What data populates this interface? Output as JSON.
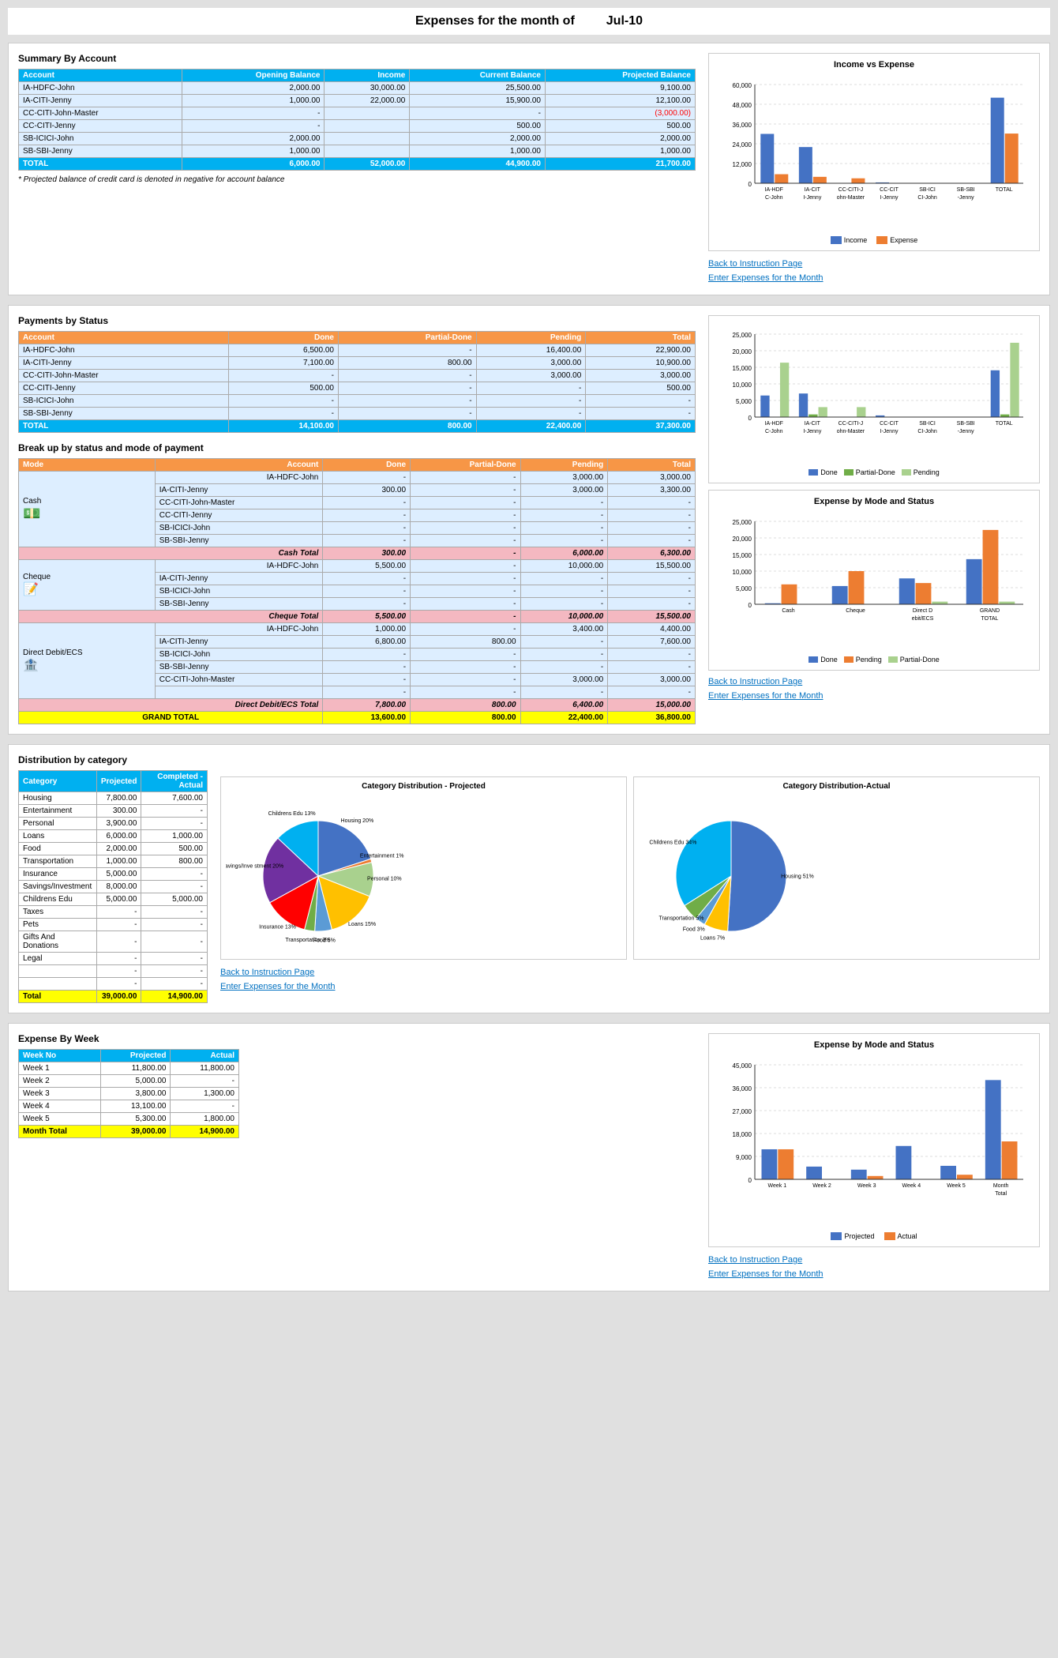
{
  "page": {
    "title": "Expenses for the month of",
    "month": "Jul-10"
  },
  "section1": {
    "title": "Summary By Account",
    "table": {
      "headers": [
        "Account",
        "Opening Balance",
        "Income",
        "Current Balance",
        "Projected Balance"
      ],
      "rows": [
        {
          "account": "IA-HDFC-John",
          "opening": "2,000.00",
          "income": "30,000.00",
          "current": "25,500.00",
          "projected": "9,100.00",
          "neg": false
        },
        {
          "account": "IA-CITI-Jenny",
          "opening": "1,000.00",
          "income": "22,000.00",
          "current": "15,900.00",
          "projected": "12,100.00",
          "neg": false
        },
        {
          "account": "CC-CITI-John-Master",
          "opening": "-",
          "income": "",
          "current": "-",
          "projected": "(3,000.00)",
          "neg": true
        },
        {
          "account": "CC-CITI-Jenny",
          "opening": "-",
          "income": "",
          "current": "500.00",
          "projected": "500.00",
          "neg": false
        },
        {
          "account": "SB-ICICI-John",
          "opening": "2,000.00",
          "income": "",
          "current": "2,000.00",
          "projected": "2,000.00",
          "neg": false
        },
        {
          "account": "SB-SBI-Jenny",
          "opening": "1,000.00",
          "income": "",
          "current": "1,000.00",
          "projected": "1,000.00",
          "neg": false
        }
      ],
      "total": {
        "account": "TOTAL",
        "opening": "6,000.00",
        "income": "52,000.00",
        "current": "44,900.00",
        "projected": "21,700.00"
      }
    },
    "note": "* Projected balance of credit card is denoted in negative for account balance",
    "chart": {
      "title": "Income vs Expense",
      "categories": [
        "IA-HDFC-John",
        "IA-CITI-Jenny",
        "CC-CITI-John-Master",
        "CC-CITI-Jenny",
        "SB-ICICI-John",
        "SB-SBI-Jenny",
        "TOTAL"
      ],
      "income": [
        30000,
        22000,
        0,
        500,
        0,
        0,
        52000
      ],
      "expense": [
        5500,
        3900,
        3000,
        0,
        0,
        0,
        30200
      ]
    },
    "links": [
      "Back to Instruction Page",
      "Enter Expenses for the Month"
    ]
  },
  "section2": {
    "title": "Payments by Status",
    "table": {
      "headers": [
        "Account",
        "Done",
        "Partial-Done",
        "Pending",
        "Total"
      ],
      "rows": [
        {
          "account": "IA-HDFC-John",
          "done": "6,500.00",
          "partial": "-",
          "pending": "16,400.00",
          "total": "22,900.00"
        },
        {
          "account": "IA-CITI-Jenny",
          "done": "7,100.00",
          "partial": "800.00",
          "pending": "3,000.00",
          "total": "10,900.00"
        },
        {
          "account": "CC-CITI-John-Master",
          "done": "-",
          "partial": "-",
          "pending": "3,000.00",
          "total": "3,000.00"
        },
        {
          "account": "CC-CITI-Jenny",
          "done": "500.00",
          "partial": "-",
          "pending": "-",
          "total": "500.00"
        },
        {
          "account": "SB-ICICI-John",
          "done": "-",
          "partial": "-",
          "pending": "-",
          "total": "-"
        },
        {
          "account": "SB-SBI-Jenny",
          "done": "-",
          "partial": "-",
          "pending": "-",
          "total": "-"
        }
      ],
      "total": {
        "account": "TOTAL",
        "done": "14,100.00",
        "partial": "800.00",
        "pending": "22,400.00",
        "total": "37,300.00"
      }
    },
    "chart1": {
      "title": "Payments by Status",
      "categories": [
        "IA-HDFC-John",
        "IA-CITI-Jenny",
        "CC-CITI-John-Master",
        "CC-CITI-Jenny",
        "SB-ICICI-John",
        "SB-SBI-Jenny",
        "TOTAL"
      ],
      "done": [
        6500,
        7100,
        0,
        500,
        0,
        0,
        14100
      ],
      "partial": [
        0,
        800,
        0,
        0,
        0,
        0,
        800
      ],
      "pending": [
        16400,
        3000,
        3000,
        0,
        0,
        0,
        22400
      ]
    },
    "breakdown_title": "Break up by status and mode of payment",
    "breakdown_table": {
      "headers": [
        "Mode",
        "Account",
        "Done",
        "Partial-Done",
        "Pending",
        "Total"
      ],
      "cash_rows": [
        {
          "account": "IA-HDFC-John",
          "done": "-",
          "partial": "-",
          "pending": "3,000.00",
          "total": "3,000.00"
        },
        {
          "account": "IA-CITI-Jenny",
          "done": "300.00",
          "partial": "-",
          "pending": "3,000.00",
          "total": "3,300.00"
        },
        {
          "account": "CC-CITI-John-Master",
          "done": "-",
          "partial": "-",
          "pending": "-",
          "total": "-"
        },
        {
          "account": "CC-CITI-Jenny",
          "done": "-",
          "partial": "-",
          "pending": "-",
          "total": "-"
        },
        {
          "account": "SB-ICICI-John",
          "done": "-",
          "partial": "-",
          "pending": "-",
          "total": "-"
        },
        {
          "account": "SB-SBI-Jenny",
          "done": "-",
          "partial": "-",
          "pending": "-",
          "total": "-"
        }
      ],
      "cash_total": {
        "done": "300.00",
        "partial": "-",
        "pending": "6,000.00",
        "total": "6,300.00"
      },
      "cheque_rows": [
        {
          "account": "IA-HDFC-John",
          "done": "5,500.00",
          "partial": "-",
          "pending": "10,000.00",
          "total": "15,500.00"
        },
        {
          "account": "IA-CITI-Jenny",
          "done": "-",
          "partial": "-",
          "pending": "-",
          "total": "-"
        },
        {
          "account": "SB-ICICI-John",
          "done": "-",
          "partial": "-",
          "pending": "-",
          "total": "-"
        },
        {
          "account": "SB-SBI-Jenny",
          "done": "-",
          "partial": "-",
          "pending": "-",
          "total": "-"
        }
      ],
      "cheque_total": {
        "done": "5,500.00",
        "partial": "-",
        "pending": "10,000.00",
        "total": "15,500.00"
      },
      "dd_rows": [
        {
          "account": "IA-HDFC-John",
          "done": "1,000.00",
          "partial": "-",
          "pending": "3,400.00",
          "total": "4,400.00"
        },
        {
          "account": "IA-CITI-Jenny",
          "done": "6,800.00",
          "partial": "800.00",
          "pending": "-",
          "total": "7,600.00"
        },
        {
          "account": "SB-ICICI-John",
          "done": "-",
          "partial": "-",
          "pending": "-",
          "total": "-"
        },
        {
          "account": "SB-SBI-Jenny",
          "done": "-",
          "partial": "-",
          "pending": "-",
          "total": "-"
        },
        {
          "account": "CC-CITI-John-Master",
          "done": "-",
          "partial": "-",
          "pending": "3,000.00",
          "total": "3,000.00"
        },
        {
          "account": "",
          "done": "-",
          "partial": "-",
          "pending": "-",
          "total": "-"
        }
      ],
      "dd_total": {
        "done": "7,800.00",
        "partial": "800.00",
        "pending": "6,400.00",
        "total": "15,000.00"
      },
      "grand_total": {
        "done": "13,600.00",
        "partial": "800.00",
        "pending": "22,400.00",
        "total": "36,800.00"
      }
    },
    "chart2": {
      "title": "Expense by Mode and Status",
      "categories": [
        "Cash",
        "Cheque",
        "Direct Debit/ECS",
        "GRAND TOTAL"
      ],
      "done": [
        300,
        5500,
        7800,
        13600
      ],
      "pending": [
        6000,
        10000,
        6400,
        22400
      ],
      "partial": [
        0,
        0,
        800,
        800
      ]
    },
    "links": [
      "Back to Instruction Page",
      "Enter Expenses for the Month"
    ]
  },
  "section3": {
    "title": "Distribution by category",
    "table": {
      "headers": [
        "Category",
        "Projected",
        "Completed - Actual"
      ],
      "rows": [
        {
          "cat": "Housing",
          "proj": "7,800.00",
          "actual": "7,600.00"
        },
        {
          "cat": "Entertainment",
          "proj": "300.00",
          "actual": "-"
        },
        {
          "cat": "Personal",
          "proj": "3,900.00",
          "actual": "-"
        },
        {
          "cat": "Loans",
          "proj": "6,000.00",
          "actual": "1,000.00"
        },
        {
          "cat": "Food",
          "proj": "2,000.00",
          "actual": "500.00"
        },
        {
          "cat": "Transportation",
          "proj": "1,000.00",
          "actual": "800.00"
        },
        {
          "cat": "Insurance",
          "proj": "5,000.00",
          "actual": "-"
        },
        {
          "cat": "Savings/Investment",
          "proj": "8,000.00",
          "actual": "-"
        },
        {
          "cat": "Childrens Edu",
          "proj": "5,000.00",
          "actual": "5,000.00"
        },
        {
          "cat": "Taxes",
          "proj": "-",
          "actual": "-"
        },
        {
          "cat": "Pets",
          "proj": "-",
          "actual": "-"
        },
        {
          "cat": "Gifts And Donations",
          "proj": "-",
          "actual": "-"
        },
        {
          "cat": "Legal",
          "proj": "-",
          "actual": "-"
        },
        {
          "cat": "",
          "proj": "-",
          "actual": "-"
        },
        {
          "cat": "",
          "proj": "-",
          "actual": "-"
        }
      ],
      "total": {
        "cat": "Total",
        "proj": "39,000.00",
        "actual": "14,900.00"
      }
    },
    "pie_proj": {
      "title": "Category Distribution - Projected",
      "slices": [
        {
          "label": "Housing",
          "pct": 20,
          "color": "#4472c4"
        },
        {
          "label": "Entertainment",
          "pct": 1,
          "color": "#ed7d31"
        },
        {
          "label": "Personal",
          "pct": 10,
          "color": "#a9d18e"
        },
        {
          "label": "Loans",
          "pct": 15,
          "color": "#ffc000"
        },
        {
          "label": "Food",
          "pct": 5,
          "color": "#5b9bd5"
        },
        {
          "label": "Transportation",
          "pct": 3,
          "color": "#70ad47"
        },
        {
          "label": "Insurance",
          "pct": 13,
          "color": "#ff0000"
        },
        {
          "label": "Savings/Inve stment",
          "pct": 20,
          "color": "#7030a0"
        },
        {
          "label": "Childrens Edu",
          "pct": 13,
          "color": "#00b0f0"
        }
      ]
    },
    "pie_actual": {
      "title": "Category Distribution-Actual",
      "slices": [
        {
          "label": "Housing",
          "pct": 51,
          "color": "#4472c4"
        },
        {
          "label": "Loans",
          "pct": 7,
          "color": "#ffc000"
        },
        {
          "label": "Food",
          "pct": 3,
          "color": "#5b9bd5"
        },
        {
          "label": "Transportation",
          "pct": 5,
          "color": "#70ad47"
        },
        {
          "label": "Childrens Edu",
          "pct": 34,
          "color": "#00b0f0"
        }
      ]
    },
    "links": [
      "Back to Instruction Page",
      "Enter Expenses for the Month"
    ]
  },
  "section4": {
    "title": "Expense By Week",
    "table": {
      "headers": [
        "Week No",
        "Projected",
        "Actual"
      ],
      "rows": [
        {
          "week": "Week 1",
          "proj": "11,800.00",
          "actual": "11,800.00"
        },
        {
          "week": "Week 2",
          "proj": "5,000.00",
          "actual": "-"
        },
        {
          "week": "Week 3",
          "proj": "3,800.00",
          "actual": "1,300.00"
        },
        {
          "week": "Week 4",
          "proj": "13,100.00",
          "actual": "-"
        },
        {
          "week": "Week 5",
          "proj": "5,300.00",
          "actual": "1,800.00"
        }
      ],
      "total": {
        "week": "Month Total",
        "proj": "39,000.00",
        "actual": "14,900.00"
      }
    },
    "chart": {
      "title": "Expense by Mode and Status",
      "categories": [
        "Week 1",
        "Week 2",
        "Week 3",
        "Week 4",
        "Week 5",
        "Month Total"
      ],
      "projected": [
        11800,
        5000,
        3800,
        13100,
        5300,
        39000
      ],
      "actual": [
        11800,
        0,
        1300,
        0,
        1800,
        14900
      ]
    },
    "links": [
      "Back to Instruction Page",
      "Enter Expenses for the Month"
    ]
  }
}
